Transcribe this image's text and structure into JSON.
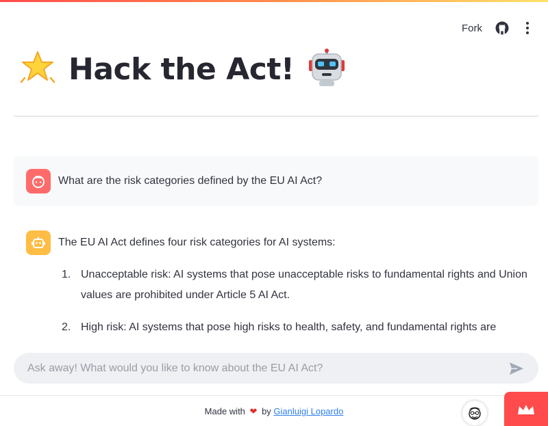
{
  "toolbar": {
    "fork_label": "Fork",
    "github_icon": "github-icon",
    "menu_icon": "kebab-menu-icon"
  },
  "header": {
    "title": "Hack the Act!",
    "left_icon": "star-icon",
    "right_icon": "robot-icon"
  },
  "chat": {
    "user_message": "What are the risk categories defined by the EU AI Act?",
    "assistant_intro": "The EU AI Act defines four risk categories for AI systems:",
    "assistant_items": [
      {
        "number": "1.",
        "text": "Unacceptable risk: AI systems that pose unacceptable risks to fundamental rights and Union values are prohibited under Article 5 AI Act."
      },
      {
        "number": "2.",
        "text": "High risk: AI systems that pose high risks to health, safety, and fundamental rights are"
      }
    ]
  },
  "input": {
    "placeholder": "Ask away! What would you like to know about the EU AI Act?"
  },
  "footer": {
    "made_with": "Made with",
    "by": "by",
    "author": "Gianluigi Lopardo"
  },
  "colors": {
    "accent": "#ff4b4b",
    "user_avatar": "#ff6b6b",
    "bot_avatar": "#ffbd45",
    "link": "#2f80ed"
  }
}
